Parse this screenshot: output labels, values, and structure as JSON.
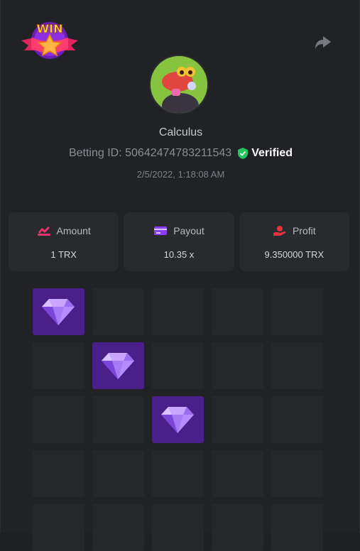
{
  "logo": {
    "text": "WIN"
  },
  "share_icon": "share-arrow-icon",
  "player": {
    "name": "Calculus",
    "betting_id_label": "Betting ID: 50642474783211543",
    "verified_label": "Verified",
    "datetime": "2/5/2022, 1:18:08 AM"
  },
  "stats": [
    {
      "label": "Amount",
      "value": "1 TRX",
      "icon": "amount-icon",
      "color": "#e8336b"
    },
    {
      "label": "Payout",
      "value": "10.35 x",
      "icon": "payout-card-icon",
      "color": "#8b3ff2"
    },
    {
      "label": "Profit",
      "value": "9.350000 TRX",
      "icon": "profit-hand-icon",
      "color": "#e2343a"
    }
  ],
  "grid": {
    "columns": 5,
    "visible_rows": 5,
    "gems": [
      [
        0,
        0
      ],
      [
        1,
        1
      ],
      [
        2,
        2
      ]
    ]
  },
  "colors": {
    "gem_tile": "#4b1f8a",
    "tile": "#26272b",
    "verified": "#22c55e"
  }
}
